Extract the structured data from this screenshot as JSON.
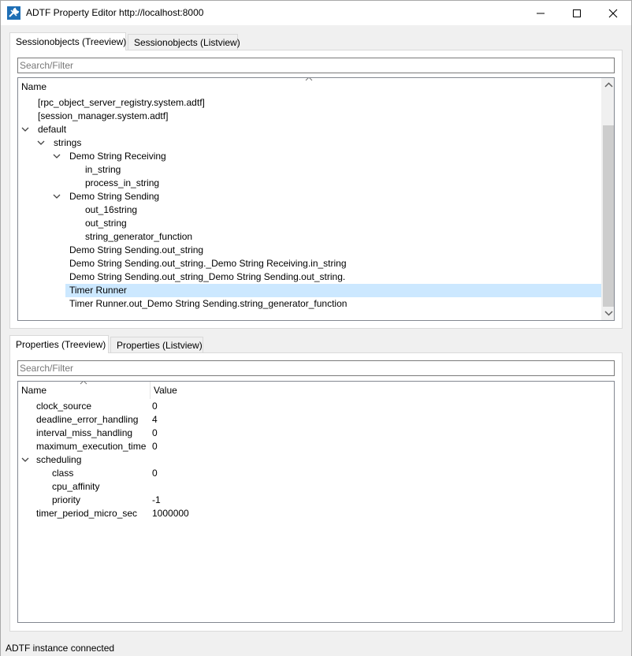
{
  "window": {
    "title": "ADTF Property Editor http://localhost:8000",
    "controls": {
      "minimize": "minimize-icon",
      "maximize": "maximize-icon",
      "close": "close-icon"
    }
  },
  "session": {
    "tabs": [
      "Sessionobjects (Treeview)",
      "Sessionobjects (Listview)"
    ],
    "active_tab": 0,
    "search_placeholder": "Search/Filter",
    "column_name": "Name",
    "rows": [
      {
        "label": "[rpc_object_server_registry.system.adtf]",
        "depth": 0,
        "expander": false
      },
      {
        "label": "[session_manager.system.adtf]",
        "depth": 0,
        "expander": false
      },
      {
        "label": "default",
        "depth": 0,
        "expander": true
      },
      {
        "label": "strings",
        "depth": 1,
        "expander": true
      },
      {
        "label": "Demo String Receiving",
        "depth": 2,
        "expander": true
      },
      {
        "label": "in_string",
        "depth": 3,
        "expander": false
      },
      {
        "label": "process_in_string",
        "depth": 3,
        "expander": false
      },
      {
        "label": "Demo String Sending",
        "depth": 2,
        "expander": true
      },
      {
        "label": "out_16string",
        "depth": 3,
        "expander": false
      },
      {
        "label": "out_string",
        "depth": 3,
        "expander": false
      },
      {
        "label": "string_generator_function",
        "depth": 3,
        "expander": false
      },
      {
        "label": "Demo String Sending.out_string",
        "depth": 2,
        "expander": false
      },
      {
        "label": "Demo String Sending.out_string._Demo String Receiving.in_string",
        "depth": 2,
        "expander": false
      },
      {
        "label": "Demo String Sending.out_string_Demo String Sending.out_string.",
        "depth": 2,
        "expander": false
      },
      {
        "label": "Timer Runner",
        "depth": 2,
        "expander": false,
        "selected": true
      },
      {
        "label": "Timer Runner.out_Demo String Sending.string_generator_function",
        "depth": 2,
        "expander": false
      }
    ]
  },
  "properties": {
    "tabs": [
      "Properties (Treeview)",
      "Properties (Listview)"
    ],
    "active_tab": 0,
    "search_placeholder": "Search/Filter",
    "column_name": "Name",
    "column_value": "Value",
    "rows": [
      {
        "name": "clock_source",
        "value": "0",
        "depth": 0,
        "expander": false
      },
      {
        "name": "deadline_error_handling",
        "value": "4",
        "depth": 0,
        "expander": false
      },
      {
        "name": "interval_miss_handling",
        "value": "0",
        "depth": 0,
        "expander": false
      },
      {
        "name": "maximum_execution_time",
        "value": "0",
        "depth": 0,
        "expander": false
      },
      {
        "name": "scheduling",
        "value": "",
        "depth": 0,
        "expander": true
      },
      {
        "name": "class",
        "value": "0",
        "depth": 1,
        "expander": false
      },
      {
        "name": "cpu_affinity",
        "value": "",
        "depth": 1,
        "expander": false
      },
      {
        "name": "priority",
        "value": "-1",
        "depth": 1,
        "expander": false
      },
      {
        "name": "timer_period_micro_sec",
        "value": "1000000",
        "depth": 0,
        "expander": false
      }
    ]
  },
  "status": {
    "text": "ADTF instance connected"
  },
  "colors": {
    "selection": "#cce8ff",
    "window_bg": "#f0f0f0",
    "border": "#828790"
  }
}
